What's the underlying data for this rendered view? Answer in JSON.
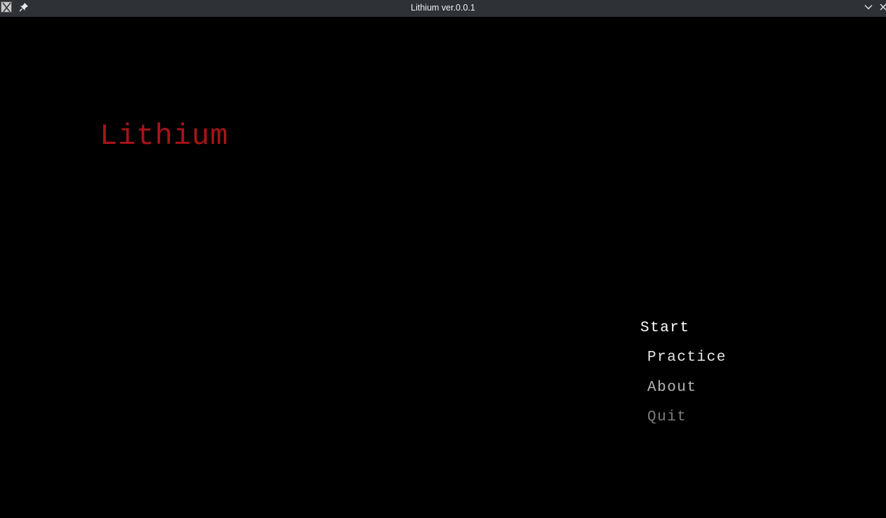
{
  "window": {
    "title": "Lithium ver.0.0.1",
    "icons": {
      "app": "x-app-icon",
      "pin": "pin-icon",
      "minimize": "chevron-down-icon",
      "close": "close-icon"
    }
  },
  "game": {
    "title": "Lithium",
    "title_color": "#a8141a",
    "background_color": "#000000",
    "menu": [
      {
        "label": "Start",
        "color": "#ffffff",
        "selected": true
      },
      {
        "label": "Practice",
        "color": "#e6e6e6",
        "selected": false
      },
      {
        "label": "About",
        "color": "#b4b4b4",
        "selected": false
      },
      {
        "label": "Quit",
        "color": "#7c7c7c",
        "selected": false
      }
    ]
  }
}
